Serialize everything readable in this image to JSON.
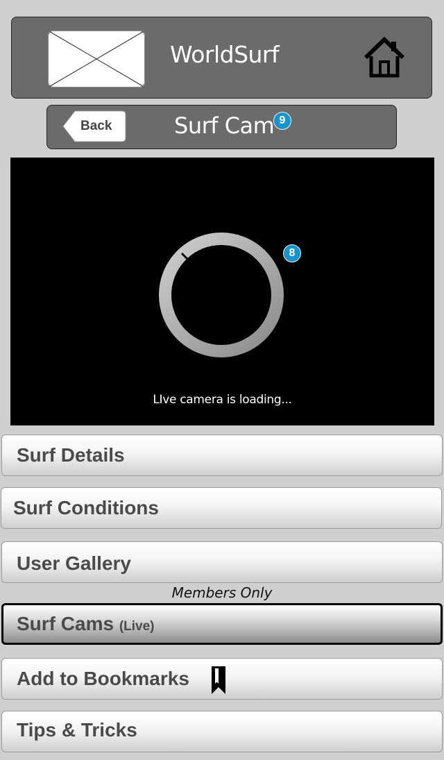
{
  "header": {
    "logo": "logo-placeholder",
    "title": "WorldSurf",
    "home_icon": "home-icon"
  },
  "subheader": {
    "back_label": "Back",
    "title": "Surf Cam",
    "badge": "9"
  },
  "video": {
    "badge": "8",
    "loading_text": "LIve camera is loading...",
    "spinner_icon": "loading-spinner-icon"
  },
  "menu": {
    "surf_details": "Surf Details",
    "surf_conditions": "Surf Conditions",
    "user_gallery": "User Gallery",
    "members_only": "Members Only",
    "surf_cams": "Surf Cams",
    "surf_cams_sub": "(Live)",
    "add_bookmarks": "Add to Bookmarks",
    "tips_tricks": "Tips & Tricks"
  },
  "colors": {
    "background": "#cfcfcf",
    "header": "#6b6b6b",
    "badge": "#1a93c9",
    "video_bg": "#000000"
  }
}
